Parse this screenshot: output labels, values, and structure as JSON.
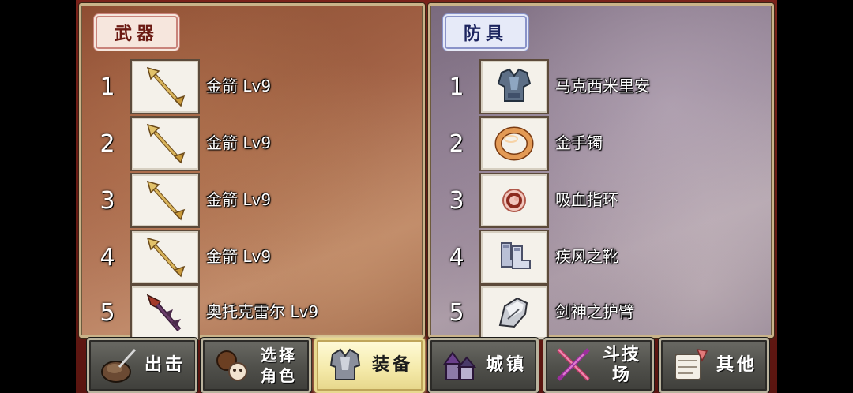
{
  "weapons": {
    "title": "武器",
    "items": [
      {
        "index": "1",
        "name": "金箭 Lv9",
        "icon": "golden-arrow-icon"
      },
      {
        "index": "2",
        "name": "金箭 Lv9",
        "icon": "golden-arrow-icon"
      },
      {
        "index": "3",
        "name": "金箭 Lv9",
        "icon": "golden-arrow-icon"
      },
      {
        "index": "4",
        "name": "金箭 Lv9",
        "icon": "golden-arrow-icon"
      },
      {
        "index": "5",
        "name": "奥托克雷尔 Lv9",
        "icon": "spear-icon"
      }
    ]
  },
  "armor": {
    "title": "防具",
    "items": [
      {
        "index": "1",
        "name": "马克西米里安",
        "icon": "plate-armor-icon"
      },
      {
        "index": "2",
        "name": "金手镯",
        "icon": "bracelet-icon"
      },
      {
        "index": "3",
        "name": "吸血指环",
        "icon": "ring-icon"
      },
      {
        "index": "4",
        "name": "疾风之靴",
        "icon": "boots-icon"
      },
      {
        "index": "5",
        "name": "剑神之护臂",
        "icon": "gauntlet-icon"
      }
    ]
  },
  "nav": {
    "sortie": "出击",
    "select_character": "选择角色",
    "equipment": "装备",
    "town": "城镇",
    "arena": "斗技场",
    "other": "其他",
    "active": "equipment"
  },
  "colors": {
    "weapon_tab_text": "#6b1a13",
    "armor_tab_text": "#1b235e",
    "active_button": "#f4e9a8"
  }
}
